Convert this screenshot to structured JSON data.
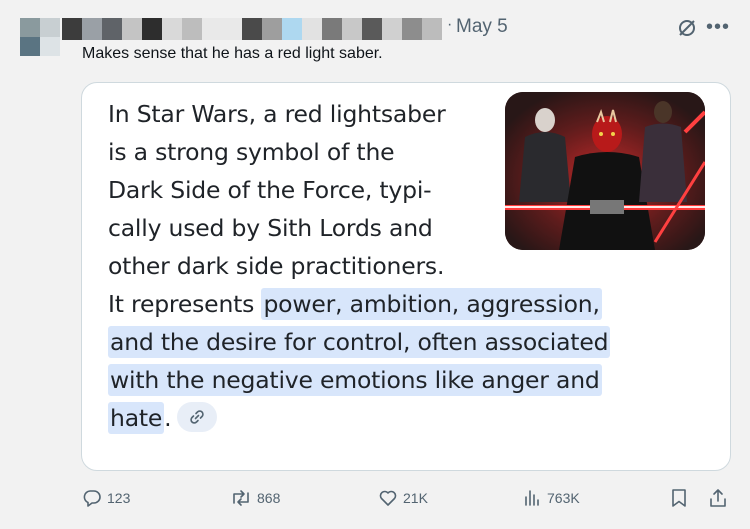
{
  "post": {
    "date": "May 5",
    "reply_text": "Makes sense that he has a red light saber."
  },
  "answer": {
    "lines": [
      "In Star Wars, a red lightsaber",
      "is a strong symbol of the",
      "Dark Side of the Force, typi-",
      "cally used by Sith Lords and",
      "other dark side practitioners.",
      "It represents "
    ],
    "highlighted": [
      "power, ambition, aggression,",
      "and the desire for control, often associated",
      "with the negative emotions like anger and",
      "hate"
    ],
    "trailing": "."
  },
  "actions": {
    "replies": "123",
    "reposts": "868",
    "likes": "21K",
    "views": "763K"
  },
  "icons": {
    "grok": "grok-icon",
    "more": "more-icon",
    "link": "link-icon",
    "reply": "reply-icon",
    "repost": "repost-icon",
    "like": "heart-icon",
    "views": "views-icon",
    "bookmark": "bookmark-icon",
    "share": "share-icon"
  },
  "colors": {
    "highlight": "#d8e6fb",
    "muted": "#536471",
    "background": "#f2f2f2"
  }
}
